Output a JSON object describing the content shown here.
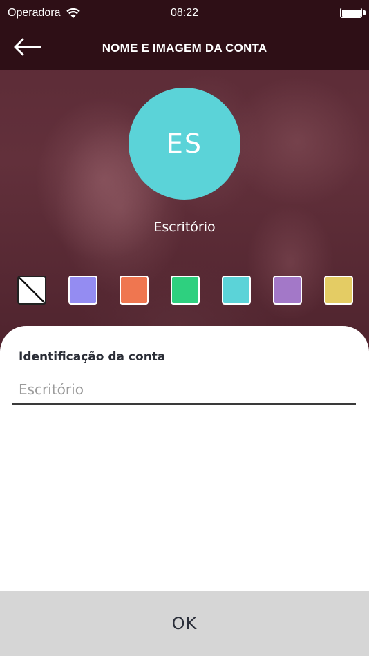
{
  "status_bar": {
    "carrier": "Operadora",
    "time": "08:22"
  },
  "header": {
    "title": "NOME E IMAGEM DA CONTA",
    "back_icon": "arrow-left-icon"
  },
  "account": {
    "initials": "ES",
    "name": "Escritório",
    "avatar_color": "#5bd3d8"
  },
  "colors": {
    "options": [
      {
        "name": "none",
        "hex": "#ffffff"
      },
      {
        "name": "lavender",
        "hex": "#948cf2"
      },
      {
        "name": "orange",
        "hex": "#ef7650"
      },
      {
        "name": "green",
        "hex": "#2ed07f"
      },
      {
        "name": "cyan",
        "hex": "#5bd3d8"
      },
      {
        "name": "purple",
        "hex": "#a378c8"
      },
      {
        "name": "yellow",
        "hex": "#e4cc64"
      }
    ]
  },
  "form": {
    "label": "Identificação da conta",
    "placeholder": "Escritório",
    "value": ""
  },
  "footer": {
    "ok_label": "OK"
  }
}
